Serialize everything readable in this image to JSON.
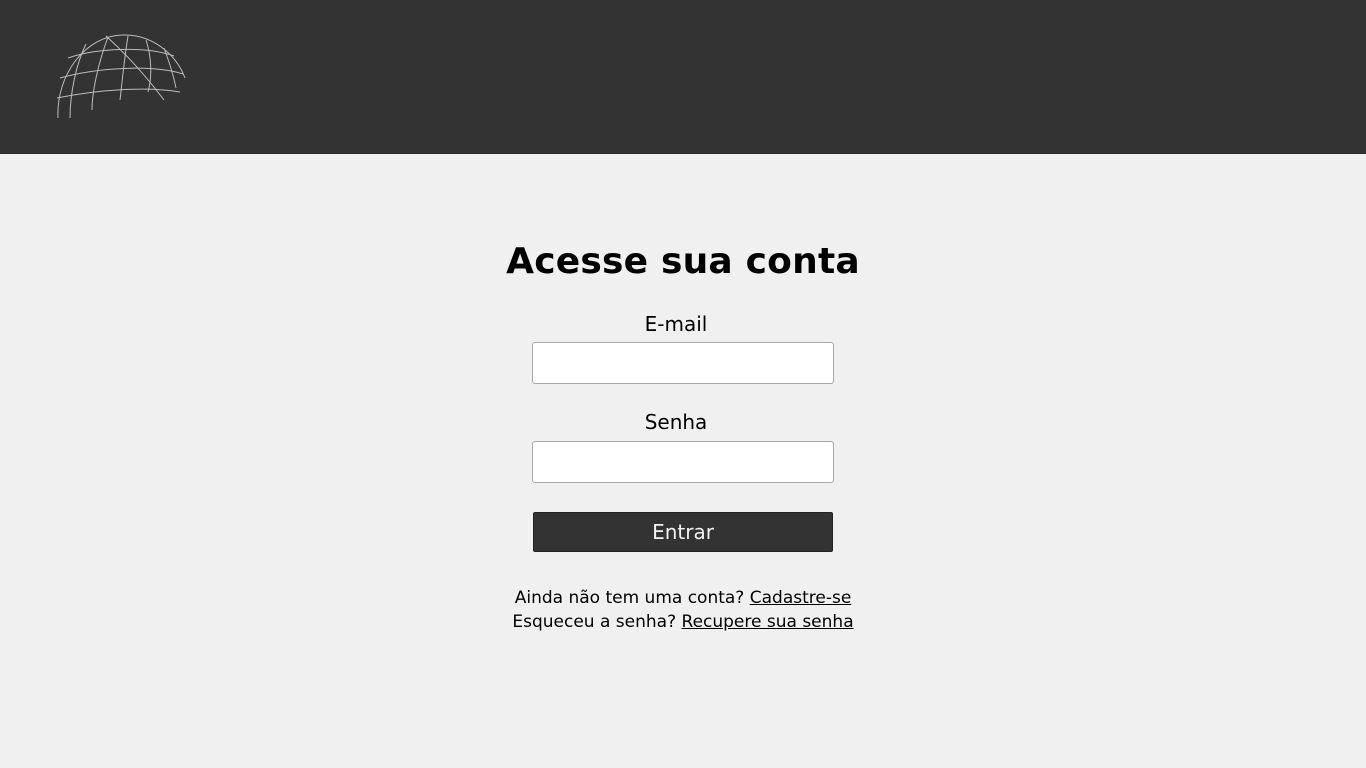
{
  "header": {
    "logo_icon": "globe-wireframe-icon"
  },
  "login": {
    "title": "Acesse sua conta",
    "email_label": "E-mail",
    "email_value": "",
    "password_label": "Senha",
    "password_value": "",
    "submit_label": "Entrar"
  },
  "links": {
    "signup_prompt": "Ainda não tem uma conta?",
    "signup_link": "Cadastre-se",
    "recover_prompt": "Esqueceu a senha?",
    "recover_link": "Recupere sua senha"
  },
  "colors": {
    "header_bg": "#333333",
    "page_bg": "#f0f0f0",
    "button_bg": "#333333",
    "button_text": "#f2f2f2"
  }
}
